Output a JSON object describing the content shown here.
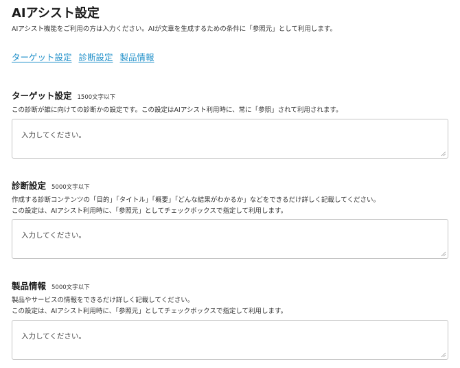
{
  "header": {
    "title": "AIアシスト設定",
    "description": "AIアシスト機能をご利用の方は入力ください。AIが文章を生成するための条件に「参照元」として利用します。"
  },
  "nav": {
    "links": [
      {
        "label": "ターゲット設定"
      },
      {
        "label": "診断設定"
      },
      {
        "label": "製品情報"
      }
    ]
  },
  "sections": {
    "target": {
      "title": "ターゲット設定",
      "limit": "1500文字以下",
      "description": [
        "この診断が誰に向けての診断かの設定です。この設定はAIアシスト利用時に、常に「参照」されて利用されます。"
      ],
      "placeholder": "入力してください。"
    },
    "diagnosis": {
      "title": "診断設定",
      "limit": "5000文字以下",
      "description": [
        "作成する診断コンテンツの「目的」「タイトル」「概要」「どんな結果がわかるか」などをできるだけ詳しく記載してください。",
        "この設定は、AIアシスト利用時に、「参照元」としてチェックボックスで指定して利用します。"
      ],
      "placeholder": "入力してください。"
    },
    "product": {
      "title": "製品情報",
      "limit": "5000文字以下",
      "description": [
        "製品やサービスの情報をできるだけ詳しく記載してください。",
        "この設定は、AIアシスト利用時に、「参照元」としてチェックボックスで指定して利用します。"
      ],
      "placeholder": "入力してください。"
    }
  },
  "colors": {
    "link": "#1f8fc9",
    "border": "#c4c4c4",
    "text": "#222222"
  }
}
